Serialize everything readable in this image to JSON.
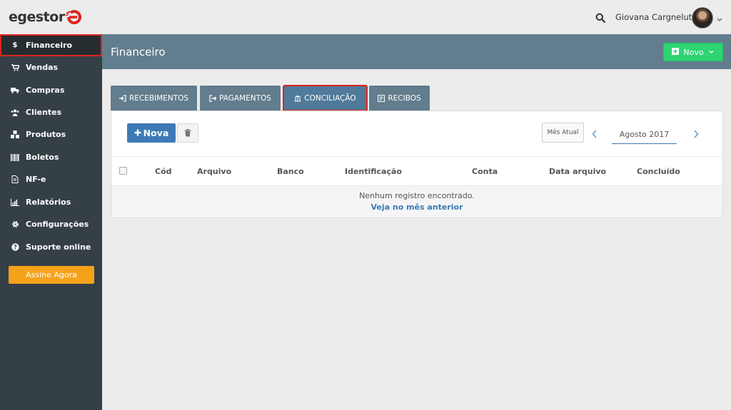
{
  "app": {
    "logo_text": "egestor",
    "user_name": "Giovana Cargnelutti"
  },
  "sidebar": {
    "items": [
      {
        "label": "Financeiro",
        "icon": "dollar-icon",
        "active": true
      },
      {
        "label": "Vendas",
        "icon": "cart-icon",
        "active": false
      },
      {
        "label": "Compras",
        "icon": "truck-icon",
        "active": false
      },
      {
        "label": "Clientes",
        "icon": "users-icon",
        "active": false
      },
      {
        "label": "Produtos",
        "icon": "cubes-icon",
        "active": false
      },
      {
        "label": "Boletos",
        "icon": "barcode-icon",
        "active": false
      },
      {
        "label": "NF-e",
        "icon": "file-icon",
        "active": false
      },
      {
        "label": "Relatórios",
        "icon": "bar-chart-icon",
        "active": false
      },
      {
        "label": "Configurações",
        "icon": "gear-icon",
        "active": false
      },
      {
        "label": "Suporte online",
        "icon": "question-icon",
        "active": false
      }
    ],
    "cta_label": "Assine Agora"
  },
  "header": {
    "title": "Financeiro",
    "new_button_label": "Novo"
  },
  "tabs": [
    {
      "label": "RECEBIMENTOS",
      "icon": "sign-in-icon",
      "active": false
    },
    {
      "label": "PAGAMENTOS",
      "icon": "sign-out-icon",
      "active": false
    },
    {
      "label": "CONCILIAÇÃO",
      "icon": "bank-icon",
      "active": true
    },
    {
      "label": "RECIBOS",
      "icon": "receipt-icon",
      "active": false
    }
  ],
  "toolbar": {
    "nova_label": "Nova",
    "current_month_label": "Mês Atual",
    "month_value": "Agosto 2017"
  },
  "table": {
    "columns": [
      "Cód",
      "Arquivo",
      "Banco",
      "Identificação",
      "Conta",
      "Data arquivo",
      "Concluído"
    ],
    "empty_message": "Nenhum registro encontrado.",
    "previous_month_link": "Veja no mês anterior"
  },
  "colors": {
    "sidebar_bg": "#353f46",
    "header_bg": "#627d8d",
    "primary_blue": "#3d7ab5",
    "success_green": "#2ed573",
    "cta_orange": "#f5a21b",
    "highlight_red": "#e0231e"
  }
}
